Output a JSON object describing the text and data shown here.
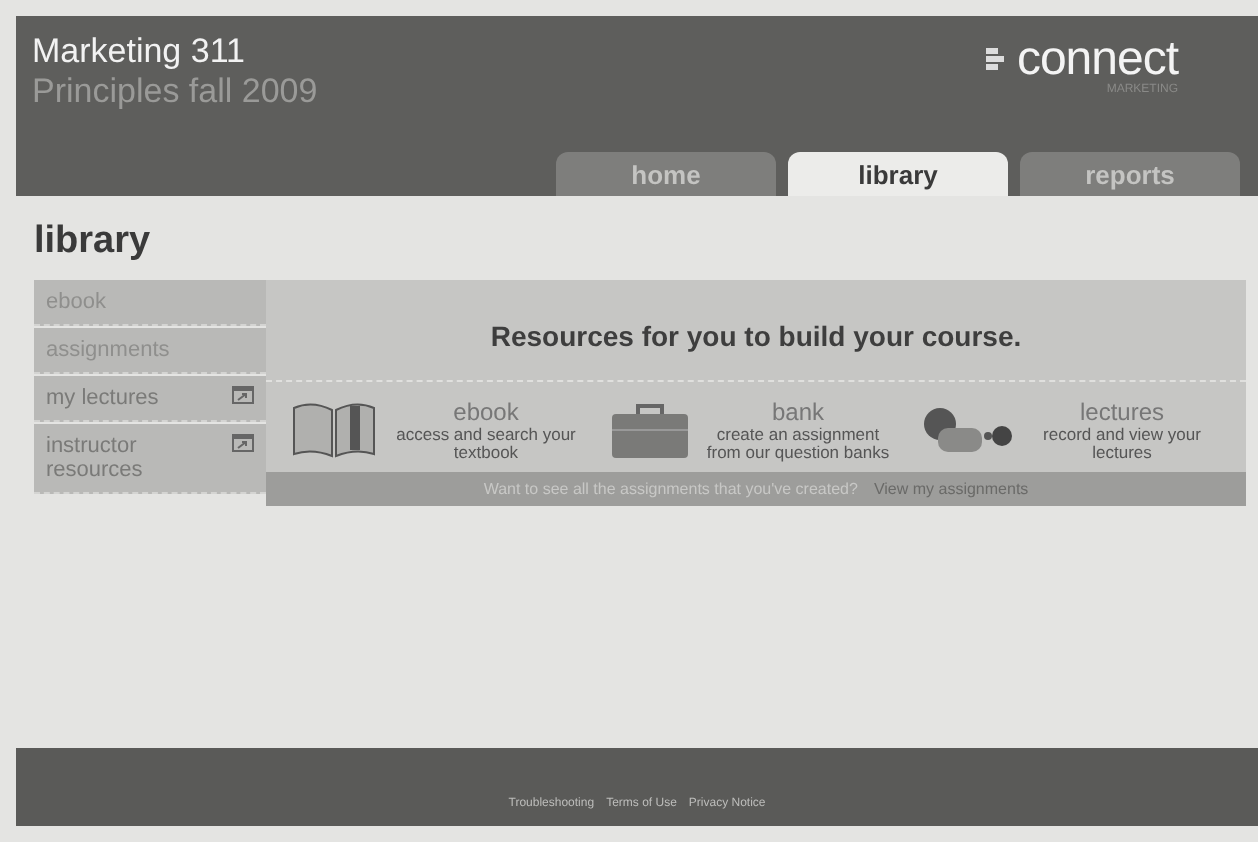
{
  "header": {
    "course": "Marketing 311",
    "term": "Principles fall 2009",
    "logo": {
      "wordmark": "connect",
      "sub": "MARKETING"
    }
  },
  "tabs": [
    {
      "label": "home",
      "selected": false
    },
    {
      "label": "library",
      "selected": true
    },
    {
      "label": "reports",
      "selected": false
    }
  ],
  "page_title": "library",
  "sidebar": {
    "items": [
      {
        "label": "ebook",
        "external": false
      },
      {
        "label": "assignments",
        "external": false
      },
      {
        "label": "my lectures",
        "external": true
      },
      {
        "label": "instructor resources",
        "external": true
      }
    ]
  },
  "resources": {
    "heading": "Resources for you to build your course.",
    "items": [
      {
        "kind": "book",
        "title": "ebook",
        "description": "access and search your textbook"
      },
      {
        "kind": "bank",
        "title": "bank",
        "description": "create an assignment from our question banks"
      },
      {
        "kind": "lecture",
        "title": "lectures",
        "description": "record and view your lectures"
      }
    ],
    "prompt": "Want to see all the assignments that you've created?",
    "link": "View my assignments"
  },
  "footer": {
    "links": [
      "Troubleshooting",
      "Terms of Use",
      "Privacy Notice"
    ]
  }
}
